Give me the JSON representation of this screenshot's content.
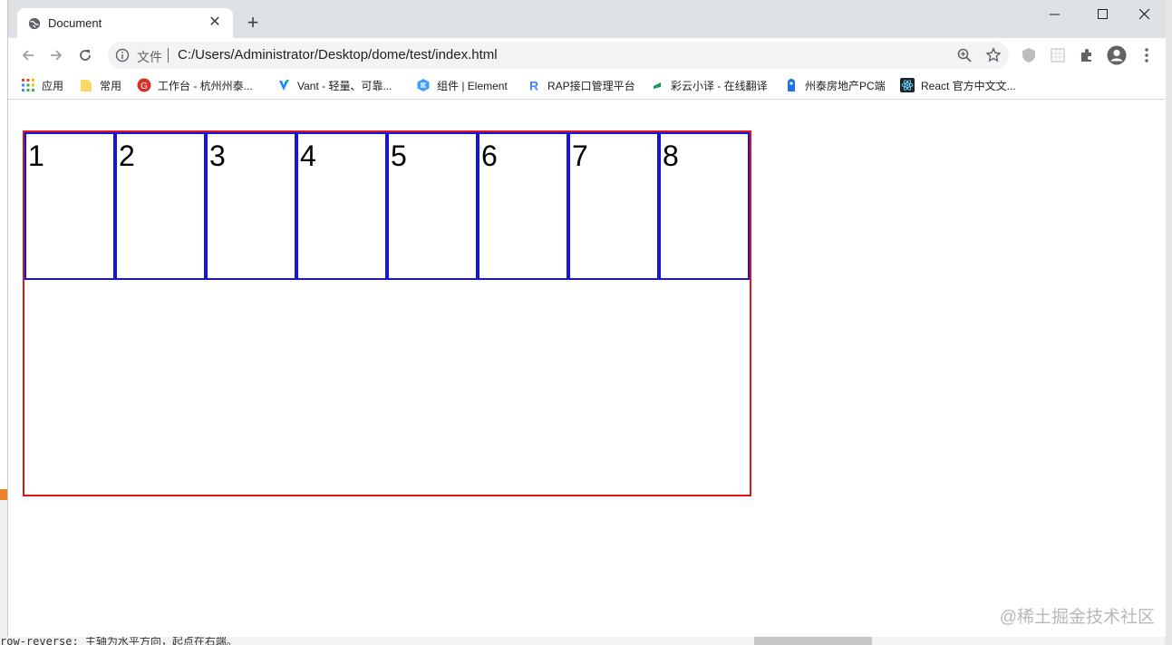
{
  "tab": {
    "title": "Document",
    "close": "✕",
    "new": "+"
  },
  "window_controls": {
    "minimize": "—",
    "maximize": "☐",
    "close": "✕"
  },
  "address": {
    "scheme": "文件",
    "url": "C:/Users/Administrator/Desktop/dome/test/index.html"
  },
  "bookmarks": [
    {
      "label": "应用",
      "icon": "apps-grid-icon"
    },
    {
      "label": "常用",
      "icon": "folder-icon"
    },
    {
      "label": "工作台 - 杭州州泰...",
      "icon": "workbench-icon"
    },
    {
      "label": "Vant - 轻量、可靠...",
      "icon": "vant-icon"
    },
    {
      "label": "组件 | Element",
      "icon": "element-icon"
    },
    {
      "label": "RAP接口管理平台",
      "icon": "rap-icon"
    },
    {
      "label": "彩云小译 - 在线翻译",
      "icon": "caiyun-icon"
    },
    {
      "label": "州泰房地产PC端",
      "icon": "property-icon"
    },
    {
      "label": "React 官方中文文...",
      "icon": "react-icon"
    }
  ],
  "boxes": [
    "1",
    "2",
    "3",
    "4",
    "5",
    "6",
    "7",
    "8"
  ],
  "watermark": "@稀土掘金技术社区",
  "background_text": "row-reverse: 主轴为水平方向，起点在右端。",
  "colors": {
    "container_border": "#e0151c",
    "box_border": "#1414e0",
    "tabstrip": "#dee1e6"
  }
}
